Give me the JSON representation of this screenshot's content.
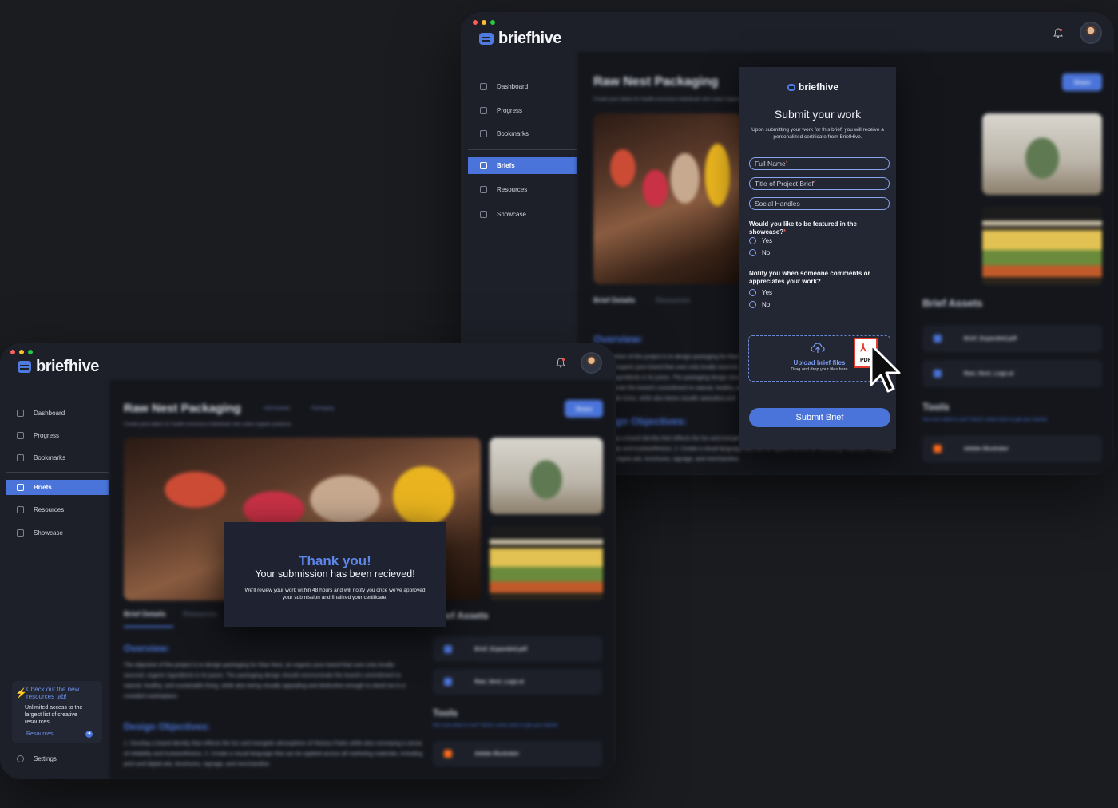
{
  "brand": {
    "name": "briefhive"
  },
  "nav": {
    "items": [
      {
        "label": "Dashboard",
        "icon": "grid-icon"
      },
      {
        "label": "Progress",
        "icon": "chart-icon"
      },
      {
        "label": "Bookmarks",
        "icon": "bookmark-icon"
      },
      {
        "label": "Briefs",
        "icon": "layers-icon",
        "active": true
      },
      {
        "label": "Resources",
        "icon": "globe-icon"
      },
      {
        "label": "Showcase",
        "icon": "image-icon"
      }
    ],
    "settings": "Settings"
  },
  "brief": {
    "title": "Raw Nest Packaging",
    "tags": [
      "Intermediate",
      "Packaging"
    ],
    "subtitle": "Create juice labels for health-conscious individuals who value organic products.",
    "share": "Share",
    "tabs": [
      "Brief Details",
      "Resources"
    ],
    "overview_heading": "Overview:",
    "overview_text": "The objective of this project is to design packaging for Raw Nest, an organic juice brand that uses only locally-sourced, organic ingredients in its juices. The packaging design should communicate the brand's commitment to natural, healthy, and sustainable living, while also being visually appealing and distinctive enough to stand out in a crowded marketplace.",
    "objectives_heading": "Design Objectives:",
    "objectives_text": "1. Develop a brand identity that reflects the fun and energetic atmosphere of Hickory Parks while also conveying a sense of reliability and trustworthiness. 2. Create a visual language that can be applied across all marketing materials, including print and digital ads, brochures, signage, and merchandise.",
    "assets_heading": "Brief Assets",
    "assets": [
      "Brief_Expanded.pdf",
      "Raw_Nest_Logo.ai"
    ],
    "tools_heading": "Tools",
    "tools_sub": "Not sure what to use? Here's some tools to get you started",
    "tools": [
      "Adobe Illustrator"
    ]
  },
  "submit_form": {
    "brand": "briefhive",
    "title": "Submit your work",
    "description": "Upon submitting your work for this brief, you will receive a personalized certificate from BriefHive.",
    "fields": {
      "full_name": "Full Name",
      "project_title": "Title of Project Brief",
      "social": "Social Handles"
    },
    "required_mark": "*",
    "q1": "Would you like to be featured in the showcase?",
    "q2": "Notify you when someone comments or appreciates your work?",
    "yes": "Yes",
    "no": "No",
    "upload_title": "Upload brief files",
    "upload_sub": "Drag and drop your files here",
    "pdf_label": "PDF",
    "submit": "Submit Brief"
  },
  "thanks": {
    "title": "Thank you!",
    "subtitle": "Your submission has been recieved!",
    "body": "We'll review your work within 48 hours and will notify you once we've approved your submission and finalized your certificate."
  },
  "promo": {
    "title": "Check out the new resources tab!",
    "body": "Unlimited access to the largest list of creative resources.",
    "link": "Resources"
  },
  "colors": {
    "accent": "#4a74d9",
    "background": "#1b1c20",
    "panel": "#1e2029"
  }
}
